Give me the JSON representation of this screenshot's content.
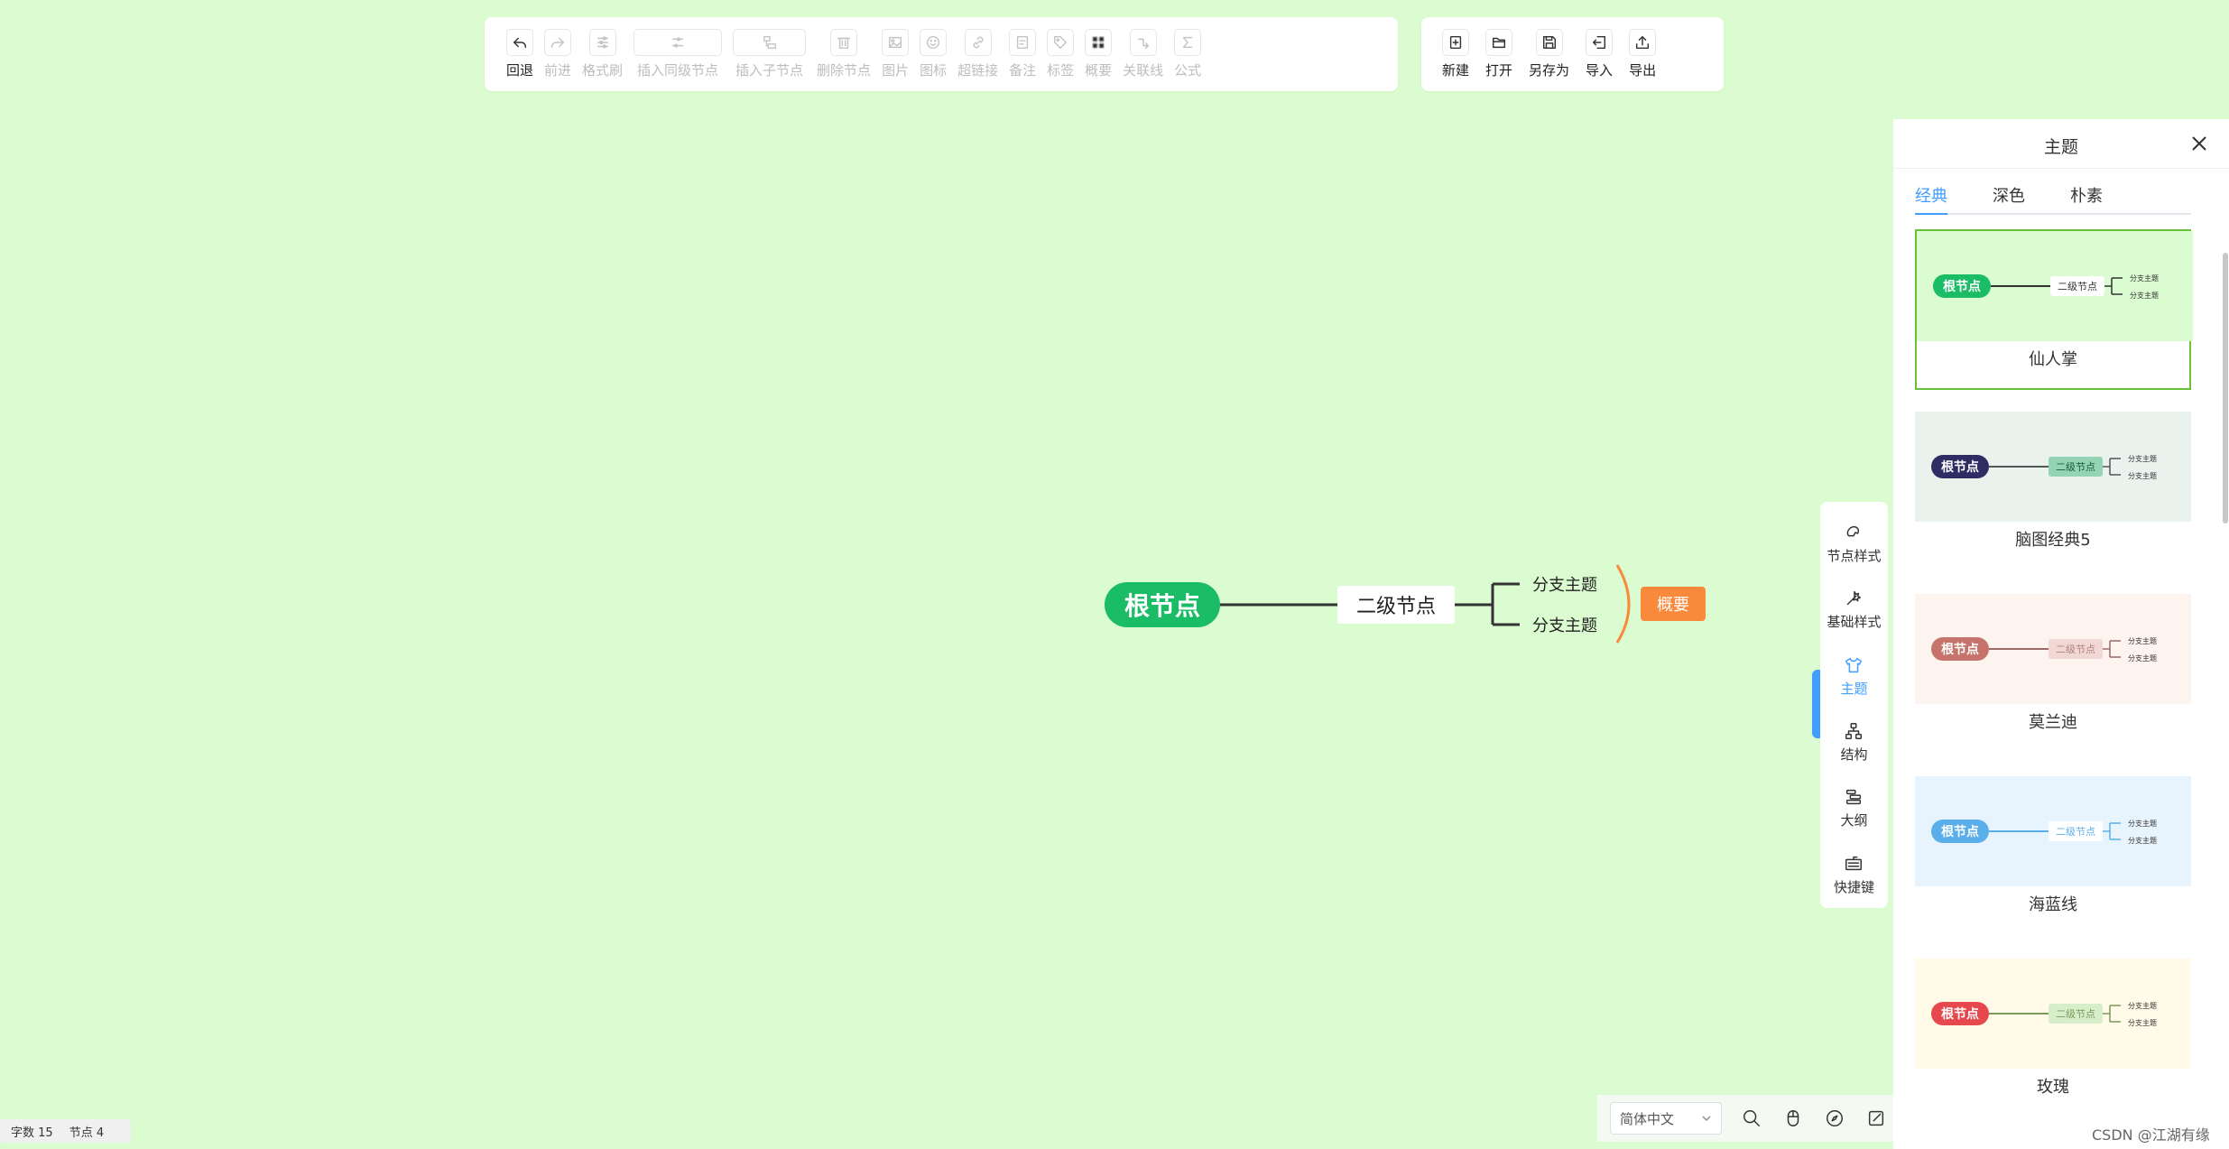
{
  "toolbar_main": [
    {
      "label": "回退",
      "icon": "undo-icon",
      "enabled": true
    },
    {
      "label": "前进",
      "icon": "redo-icon",
      "enabled": false
    },
    {
      "label": "格式刷",
      "icon": "format-brush-icon",
      "enabled": false
    },
    {
      "label": "插入同级节点",
      "icon": "sibling-node-icon",
      "enabled": false
    },
    {
      "label": "插入子节点",
      "icon": "child-node-icon",
      "enabled": false
    },
    {
      "label": "删除节点",
      "icon": "trash-icon",
      "enabled": false
    },
    {
      "label": "图片",
      "icon": "image-icon",
      "enabled": false
    },
    {
      "label": "图标",
      "icon": "smiley-icon",
      "enabled": false
    },
    {
      "label": "超链接",
      "icon": "link-icon",
      "enabled": false
    },
    {
      "label": "备注",
      "icon": "note-icon",
      "enabled": false
    },
    {
      "label": "标签",
      "icon": "tag-icon",
      "enabled": false
    },
    {
      "label": "概要",
      "icon": "summary-icon",
      "enabled": false
    },
    {
      "label": "关联线",
      "icon": "association-line-icon",
      "enabled": false
    },
    {
      "label": "公式",
      "icon": "formula-icon",
      "enabled": false
    }
  ],
  "toolbar_file": [
    {
      "label": "新建",
      "icon": "new-file-icon"
    },
    {
      "label": "打开",
      "icon": "folder-open-icon"
    },
    {
      "label": "另存为",
      "icon": "save-as-icon"
    },
    {
      "label": "导入",
      "icon": "import-icon"
    },
    {
      "label": "导出",
      "icon": "export-icon"
    }
  ],
  "mindmap": {
    "root": "根节点",
    "second": "二级节点",
    "branches": [
      "分支主题",
      "分支主题"
    ],
    "summary": "概要",
    "colors": {
      "root": "#1abc65",
      "summary": "#f9893b",
      "line": "#333333",
      "summary_bracket": "#f9893b"
    }
  },
  "side_nav": [
    {
      "label": "节点样式",
      "icon": "node-style-icon",
      "active": false
    },
    {
      "label": "基础样式",
      "icon": "base-style-icon",
      "active": false
    },
    {
      "label": "主题",
      "icon": "shirt-icon",
      "active": true
    },
    {
      "label": "结构",
      "icon": "structure-icon",
      "active": false
    },
    {
      "label": "大纲",
      "icon": "outline-icon",
      "active": false
    },
    {
      "label": "快捷键",
      "icon": "keyboard-icon",
      "active": false
    }
  ],
  "panel": {
    "title": "主题",
    "tabs": [
      {
        "label": "经典",
        "active": true
      },
      {
        "label": "深色",
        "active": false
      },
      {
        "label": "朴素",
        "active": false
      }
    ],
    "themes": [
      {
        "name": "仙人掌",
        "selected": true,
        "bg": "#dbfcd0",
        "root_bg": "#1abc65",
        "root_text": "#ffffff",
        "line": "#333333",
        "second_bg": "#ffffff",
        "second_text": "#333333",
        "root": "根节点",
        "second": "二级节点",
        "branches": [
          "分支主题",
          "分支主题"
        ]
      },
      {
        "name": "脑图经典5",
        "selected": false,
        "bg": "#eaf2ee",
        "root_bg": "#2e2d63",
        "root_text": "#ffffff",
        "line": "#555555",
        "second_bg": "#92d4b4",
        "second_text": "#1a5a3a",
        "root": "根节点",
        "second": "二级节点",
        "branches": [
          "分支主题",
          "分支主题"
        ]
      },
      {
        "name": "莫兰迪",
        "selected": false,
        "bg": "#fdf3ef",
        "root_bg": "#c6746b",
        "root_text": "#ffffff",
        "line": "#9a6a66",
        "second_bg": "#f2d8d4",
        "second_text": "#b08080",
        "root": "根节点",
        "second": "二级节点",
        "branches": [
          "分支主题",
          "分支主题"
        ]
      },
      {
        "name": "海蓝线",
        "selected": false,
        "bg": "#e8f4fd",
        "root_bg": "#5aafea",
        "root_text": "#ffffff",
        "line": "#5aafea",
        "second_bg": "#ffffff",
        "second_text": "#5aafea",
        "root": "根节点",
        "second": "二级节点",
        "branches": [
          "分支主题",
          "分支主题"
        ]
      },
      {
        "name": "玫瑰",
        "selected": false,
        "bg": "#fffbe8",
        "root_bg": "#e5484d",
        "root_text": "#ffffff",
        "line": "#7a9a5a",
        "second_bg": "#d8eecb",
        "second_text": "#7a9a5a",
        "root": "根节点",
        "second": "二级节点",
        "branches": [
          "分支主题",
          "分支主题"
        ]
      }
    ]
  },
  "status": {
    "word_count": "字数 15",
    "node_count": "节点 4"
  },
  "bottom": {
    "language": "简体中文"
  },
  "watermark": "CSDN @江湖有缘"
}
